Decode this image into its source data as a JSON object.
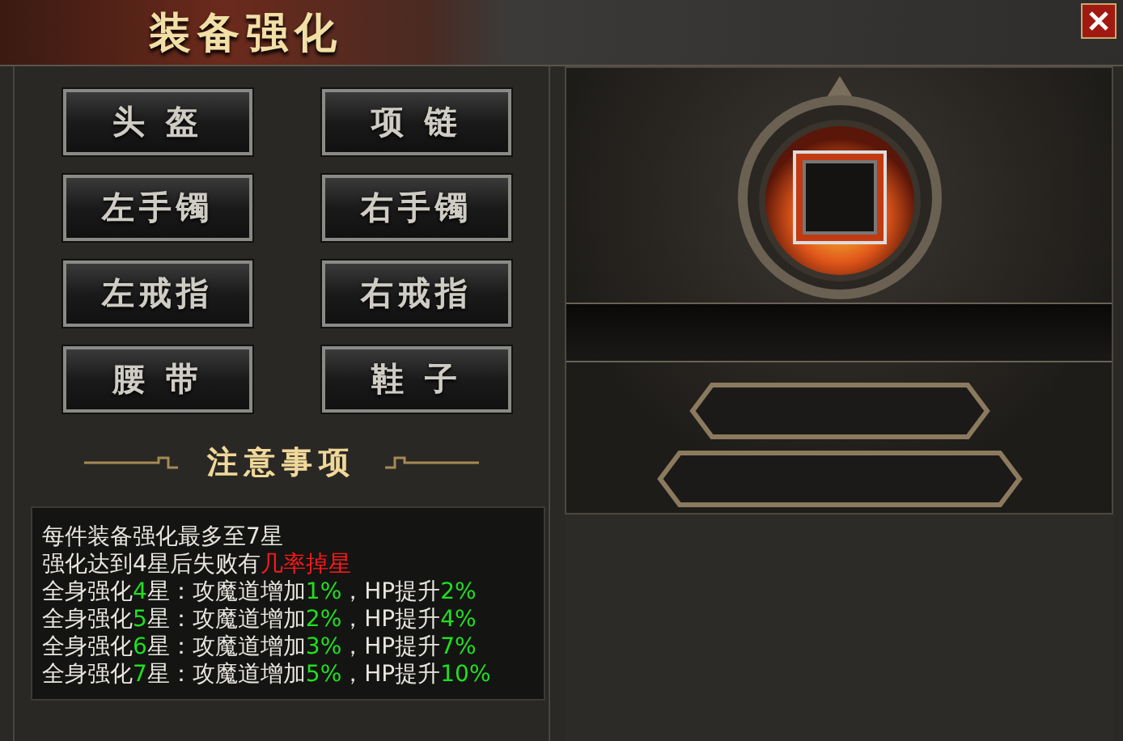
{
  "window": {
    "title": "装备强化"
  },
  "slots": [
    {
      "label": "头 盔"
    },
    {
      "label": "项 链"
    },
    {
      "label": "左手镯"
    },
    {
      "label": "右手镯"
    },
    {
      "label": "左戒指"
    },
    {
      "label": "右戒指"
    },
    {
      "label": "腰 带"
    },
    {
      "label": "鞋 子"
    }
  ],
  "notes": {
    "heading": "注意事项",
    "lines": [
      [
        {
          "kind": "plain",
          "text": "每件装备强化最多至7星"
        }
      ],
      [
        {
          "kind": "plain",
          "text": "强化达到4星后失败有"
        },
        {
          "kind": "warning",
          "text": "几率掉星"
        }
      ],
      [
        {
          "kind": "plain",
          "text": "全身强化"
        },
        {
          "kind": "highlight",
          "text": "4"
        },
        {
          "kind": "plain",
          "text": "星：攻魔道增加"
        },
        {
          "kind": "highlight",
          "text": "1%"
        },
        {
          "kind": "plain",
          "text": "，HP提升"
        },
        {
          "kind": "highlight",
          "text": "2%"
        }
      ],
      [
        {
          "kind": "plain",
          "text": "全身强化"
        },
        {
          "kind": "highlight",
          "text": "5"
        },
        {
          "kind": "plain",
          "text": "星：攻魔道增加"
        },
        {
          "kind": "highlight",
          "text": "2%"
        },
        {
          "kind": "plain",
          "text": "，HP提升"
        },
        {
          "kind": "highlight",
          "text": "4%"
        }
      ],
      [
        {
          "kind": "plain",
          "text": "全身强化"
        },
        {
          "kind": "highlight",
          "text": "6"
        },
        {
          "kind": "plain",
          "text": "星：攻魔道增加"
        },
        {
          "kind": "highlight",
          "text": "3%"
        },
        {
          "kind": "plain",
          "text": "，HP提升"
        },
        {
          "kind": "highlight",
          "text": "7%"
        }
      ],
      [
        {
          "kind": "plain",
          "text": "全身强化"
        },
        {
          "kind": "highlight",
          "text": "7"
        },
        {
          "kind": "plain",
          "text": "星：攻魔道增加"
        },
        {
          "kind": "highlight",
          "text": "5%"
        },
        {
          "kind": "plain",
          "text": "，HP提升"
        },
        {
          "kind": "highlight",
          "text": "10%"
        }
      ]
    ]
  }
}
